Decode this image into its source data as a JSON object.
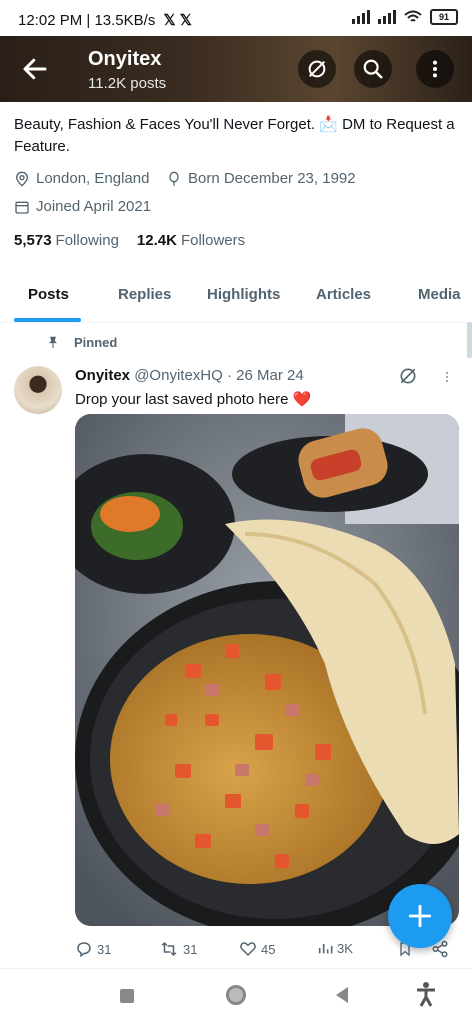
{
  "status_bar": {
    "time": "12:02 PM",
    "speed": "13.5KB/s",
    "battery": "91"
  },
  "header": {
    "title": "Onyitex",
    "posts_count": "11.2K posts"
  },
  "profile": {
    "bio": "Beauty, Fashion & Faces You'll Never Forget. 📩 DM to Request a Feature.",
    "location": "London, England",
    "born": "Born December 23, 1992",
    "joined": "Joined April 2021",
    "following_count": "5,573",
    "following_label": "Following",
    "followers_count": "12.4K",
    "followers_label": "Followers"
  },
  "tabs": [
    "Posts",
    "Replies",
    "Highlights",
    "Articles",
    "Media"
  ],
  "tweet": {
    "pinned_label": "Pinned",
    "name": "Onyitex",
    "handle": "@OnyitexHQ",
    "date": "· 26 Mar 24",
    "text": "Drop your last saved photo here ❤️",
    "replies": "31",
    "reposts": "31",
    "likes": "45",
    "views": "3K"
  },
  "colors": {
    "accent": "#1d9bf0",
    "text": "#0f1419",
    "muted": "#536471"
  },
  "icons": [
    "back-arrow-icon",
    "grok-icon",
    "search-icon",
    "more-vertical-icon",
    "location-icon",
    "balloon-icon",
    "calendar-icon",
    "pin-icon",
    "reply-icon",
    "repost-icon",
    "like-icon",
    "views-icon",
    "bookmark-icon",
    "share-icon",
    "compose-plus-icon"
  ]
}
